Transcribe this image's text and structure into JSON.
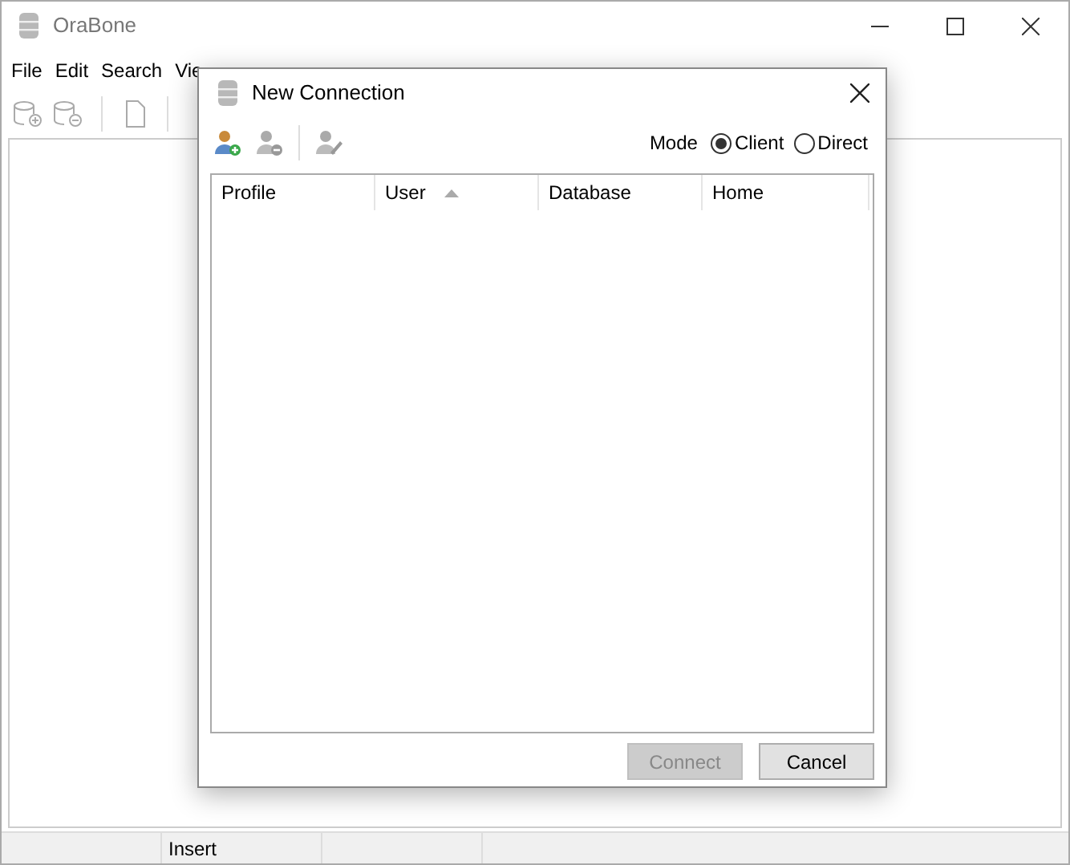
{
  "window": {
    "title": "OraBone"
  },
  "menu": [
    "File",
    "Edit",
    "Search",
    "Vie"
  ],
  "status_bar": {
    "panel_2": "Insert"
  },
  "dialog": {
    "title": "New Connection",
    "mode_label": "Mode",
    "modes": [
      {
        "label": "Client",
        "selected": true
      },
      {
        "label": "Direct",
        "selected": false
      }
    ],
    "columns": [
      {
        "label": "Profile",
        "sorted": false
      },
      {
        "label": "User",
        "sorted": true
      },
      {
        "label": "Database",
        "sorted": false
      },
      {
        "label": "Home",
        "sorted": false
      }
    ],
    "buttons": [
      {
        "label": "Connect",
        "disabled": true
      },
      {
        "label": "Cancel",
        "disabled": false
      }
    ]
  }
}
